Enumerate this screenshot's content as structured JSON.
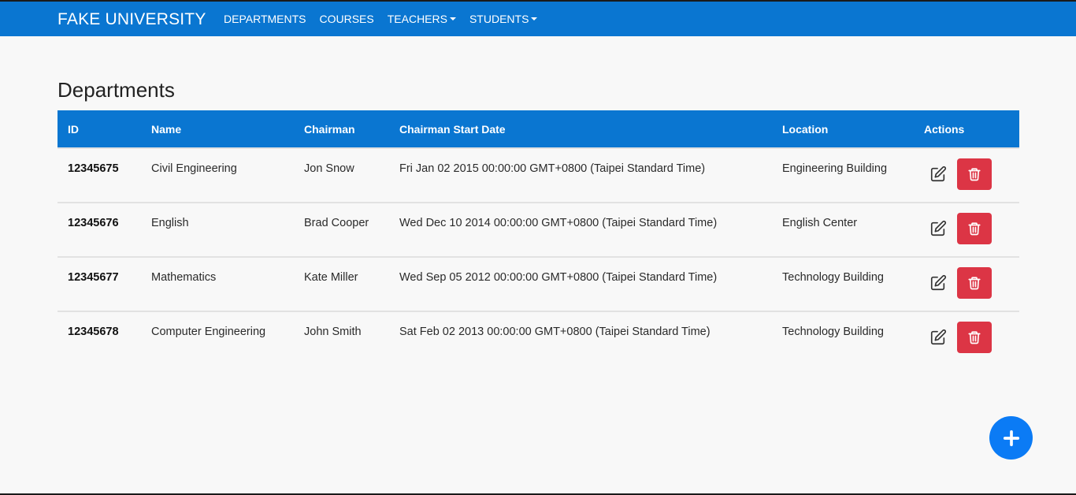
{
  "navbar": {
    "brand": "FAKE UNIVERSITY",
    "links": [
      {
        "label": "DEPARTMENTS"
      },
      {
        "label": "COURSES"
      },
      {
        "label": "TEACHERS"
      },
      {
        "label": "STUDENTS"
      }
    ]
  },
  "page": {
    "title": "Departments"
  },
  "table": {
    "headers": [
      "ID",
      "Name",
      "Chairman",
      "Chairman Start Date",
      "Location",
      "Actions"
    ],
    "rows": [
      {
        "id": "12345675",
        "name": "Civil Engineering",
        "chairman": "Jon Snow",
        "start_date": "Fri Jan 02 2015 00:00:00 GMT+0800 (Taipei Standard Time)",
        "location": "Engineering Building"
      },
      {
        "id": "12345676",
        "name": "English",
        "chairman": "Brad Cooper",
        "start_date": "Wed Dec 10 2014 00:00:00 GMT+0800 (Taipei Standard Time)",
        "location": "English Center"
      },
      {
        "id": "12345677",
        "name": "Mathematics",
        "chairman": "Kate Miller",
        "start_date": "Wed Sep 05 2012 00:00:00 GMT+0800 (Taipei Standard Time)",
        "location": "Technology Building"
      },
      {
        "id": "12345678",
        "name": "Computer Engineering",
        "chairman": "John Smith",
        "start_date": "Sat Feb 02 2013 00:00:00 GMT+0800 (Taipei Standard Time)",
        "location": "Technology Building"
      }
    ]
  },
  "icons": {
    "edit": "edit-icon",
    "delete": "trash-icon",
    "add": "plus-icon"
  },
  "colors": {
    "primary": "#0a76d1",
    "danger": "#dc3545",
    "fab": "#0b7bf5",
    "background": "#f8f8f8"
  }
}
